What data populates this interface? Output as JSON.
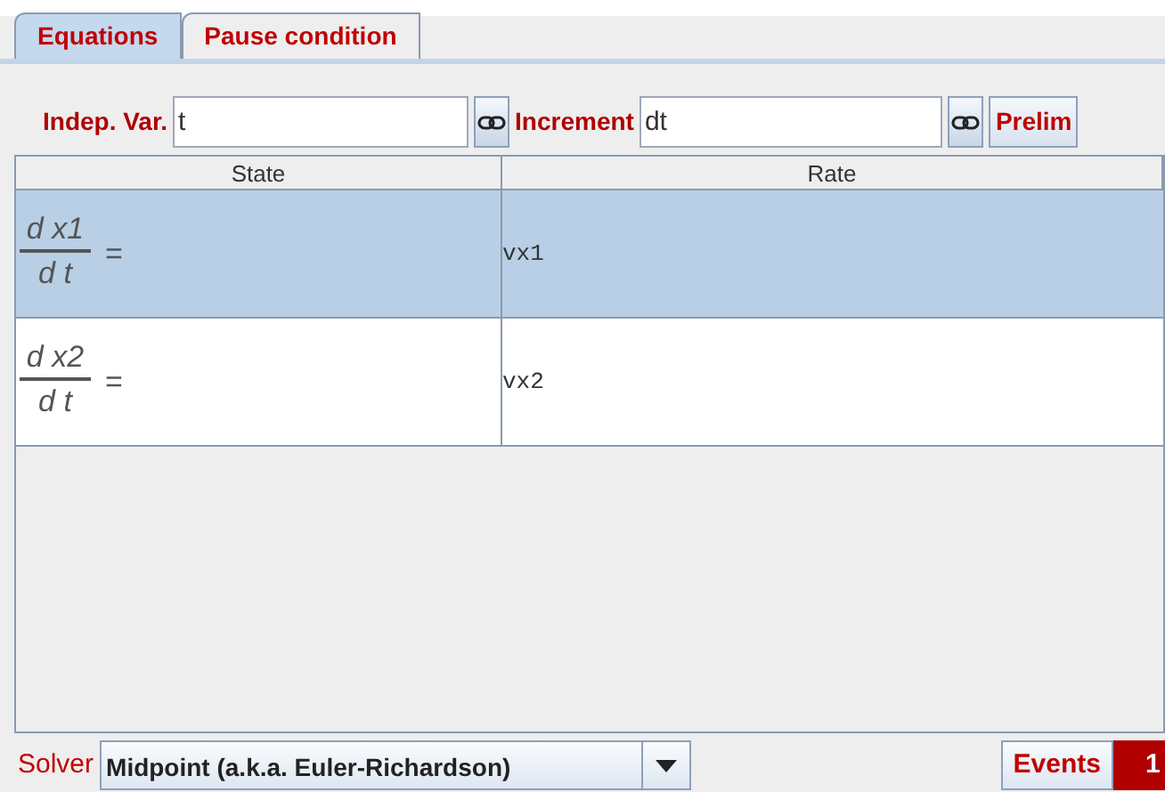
{
  "tabs": [
    {
      "label": "Equations",
      "selected": true
    },
    {
      "label": "Pause condition",
      "selected": false
    }
  ],
  "indep_var": {
    "label": "Indep. Var.",
    "value": "t"
  },
  "increment": {
    "label": "Increment",
    "value": "dt"
  },
  "prelim_button": "Prelim",
  "table": {
    "columns": [
      "State",
      "Rate"
    ],
    "rows": [
      {
        "numerator": "d x1",
        "denominator": "d t",
        "equals": "=",
        "rate": "vx1",
        "selected": true
      },
      {
        "numerator": "d x2",
        "denominator": "d t",
        "equals": "=",
        "rate": "vx2",
        "selected": false
      }
    ]
  },
  "solver": {
    "label": "Solver",
    "value": "Midpoint (a.k.a. Euler-Richardson)"
  },
  "events": {
    "label": "Events",
    "count": "1"
  }
}
